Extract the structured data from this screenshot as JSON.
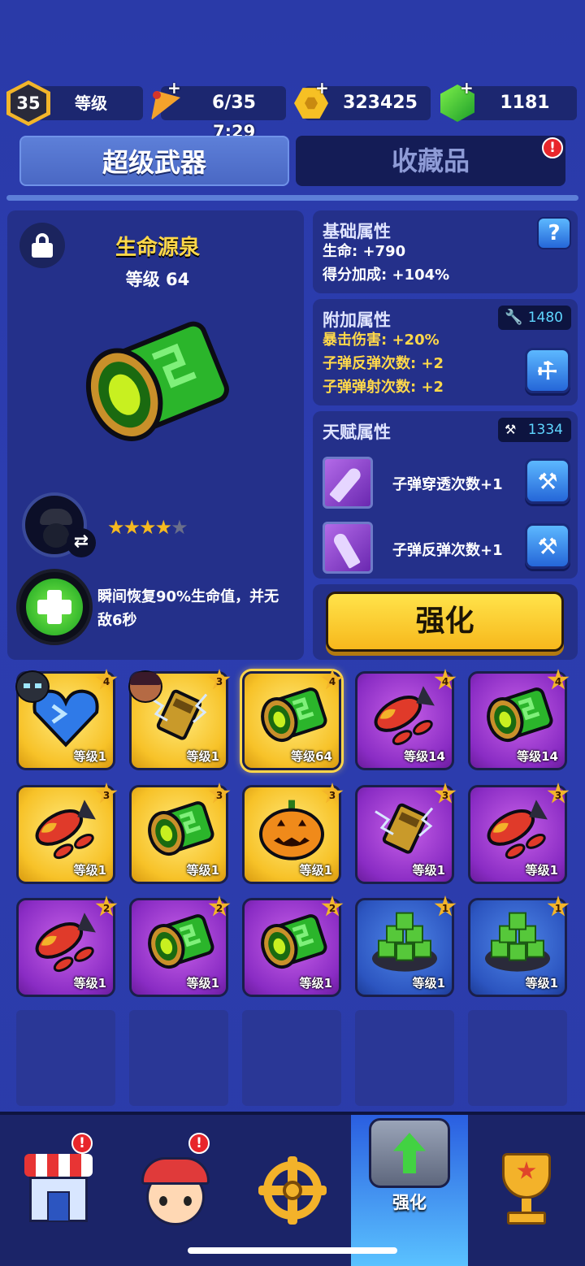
{
  "header": {
    "level": "35",
    "level_label": "等级",
    "energy": "6/35",
    "energy_timer": "7:29",
    "coins": "323425",
    "gems": "1181"
  },
  "tabs": [
    {
      "label": "超级武器",
      "active": true
    },
    {
      "label": "收藏品",
      "active": false,
      "alert": "!"
    }
  ],
  "item": {
    "name": "生命源泉",
    "level": "等级 64",
    "stars": 4,
    "max_stars": 5,
    "skill_desc": "瞬间恢复90%生命值，并无敌6秒"
  },
  "base_attrs": {
    "title": "基础属性",
    "help": "?",
    "lines": [
      "生命: +790",
      "得分加成: +104%"
    ]
  },
  "extra_attrs": {
    "title": "附加属性",
    "cost": "1480",
    "lines": [
      "暴击伤害: +20%",
      "子弹反弹次数: +2",
      "子弹弹射次数: +2"
    ]
  },
  "talent_attrs": {
    "title": "天赋属性",
    "cost": "1334",
    "items": [
      "子弹穿透次数+1",
      "子弹反弹次数+1"
    ]
  },
  "enhance_button": "强化",
  "inventory": [
    {
      "art": "heart",
      "rarity": "gold",
      "stars": "4",
      "level": "等级1",
      "portrait": "cat"
    },
    {
      "art": "bolt",
      "rarity": "gold",
      "stars": "3",
      "level": "等级1",
      "portrait": "girl"
    },
    {
      "art": "tube",
      "rarity": "gold",
      "stars": "4",
      "level": "等级64",
      "selected": true
    },
    {
      "art": "rocket",
      "rarity": "purple",
      "stars": "4",
      "level": "等级14"
    },
    {
      "art": "tube",
      "rarity": "purple",
      "stars": "4",
      "level": "等级14"
    },
    {
      "art": "rocket",
      "rarity": "gold",
      "stars": "3",
      "level": "等级1"
    },
    {
      "art": "tube",
      "rarity": "gold",
      "stars": "3",
      "level": "等级1"
    },
    {
      "art": "pumpkin",
      "rarity": "gold",
      "stars": "3",
      "level": "等级1"
    },
    {
      "art": "bolt",
      "rarity": "purple",
      "stars": "3",
      "level": "等级1"
    },
    {
      "art": "rocket",
      "rarity": "purple",
      "stars": "3",
      "level": "等级1"
    },
    {
      "art": "rocket",
      "rarity": "purple",
      "stars": "2",
      "level": "等级1"
    },
    {
      "art": "tube",
      "rarity": "purple",
      "stars": "2",
      "level": "等级1"
    },
    {
      "art": "tube",
      "rarity": "purple",
      "stars": "2",
      "level": "等级1"
    },
    {
      "art": "cubes",
      "rarity": "blue",
      "stars": "1",
      "level": "等级1"
    },
    {
      "art": "cubes",
      "rarity": "blue",
      "stars": "1",
      "level": "等级1"
    }
  ],
  "nav": [
    {
      "name": "shop-icon",
      "alert": "!"
    },
    {
      "name": "hero-icon",
      "alert": "!"
    },
    {
      "name": "target-icon"
    },
    {
      "name": "upgrade-icon",
      "label": "强化",
      "active": true
    },
    {
      "name": "trophy-icon"
    }
  ],
  "colors": {
    "gold": "#f7c228",
    "purple": "#8a2cc4",
    "blue": "#2c55c0",
    "accent": "#ffd54a"
  }
}
